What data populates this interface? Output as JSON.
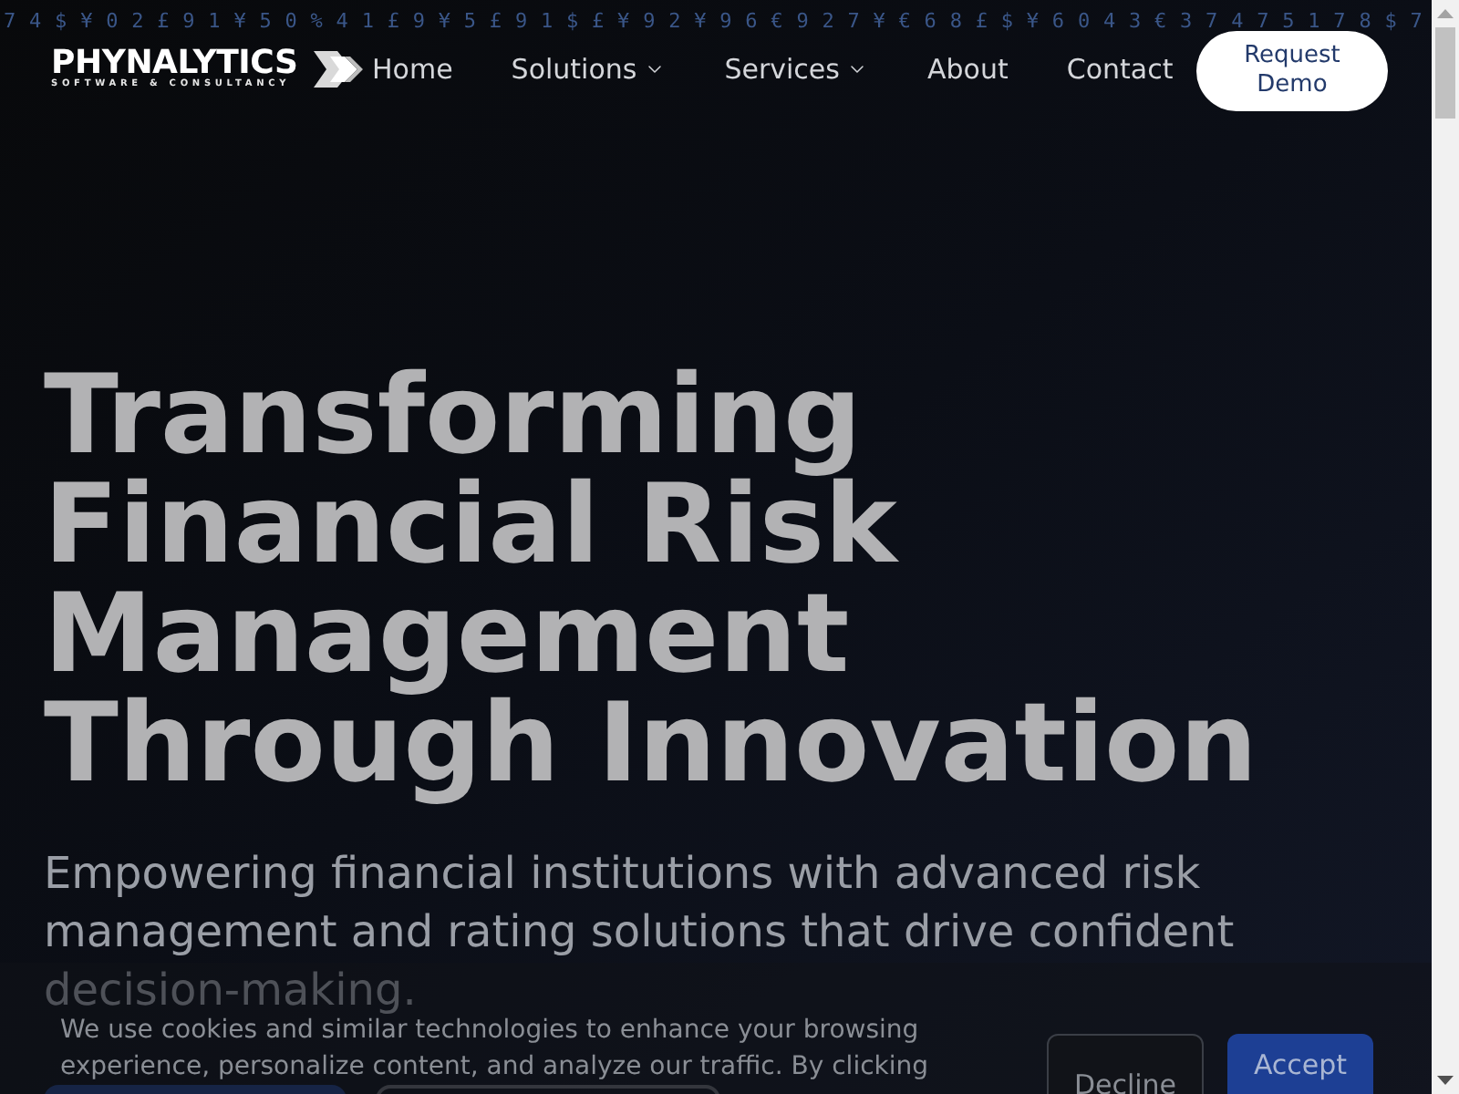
{
  "background_ticker": {
    "rows": [
      "74$¥02£91¥50%41£9¥5£91$£¥92¥96€927¥€68£$¥6043€37475178$7"
    ]
  },
  "header": {
    "logo": {
      "name": "PHYNALYTICS",
      "tagline": "SOFTWARE & CONSULTANCY"
    },
    "nav": [
      {
        "label": "Home",
        "dropdown": false
      },
      {
        "label": "Solutions",
        "dropdown": true
      },
      {
        "label": "Services",
        "dropdown": true
      },
      {
        "label": "About",
        "dropdown": false
      },
      {
        "label": "Contact",
        "dropdown": false
      }
    ],
    "cta": "Request Demo"
  },
  "hero": {
    "title": "Transforming Financial Risk Management Through Innovation",
    "subtitle": "Empowering financial institutions with advanced risk management and rating solutions that drive confident decision-making.",
    "buttons": [
      {
        "kind": "primary"
      },
      {
        "kind": "outline"
      }
    ]
  },
  "cookie_banner": {
    "message": "We use cookies and similar technologies to enhance your browsing experience, personalize content, and analyze our traffic. By clicking",
    "buttons": [
      {
        "label": "Decline",
        "kind": "outline"
      },
      {
        "label": "Accept",
        "kind": "primary"
      }
    ]
  }
}
